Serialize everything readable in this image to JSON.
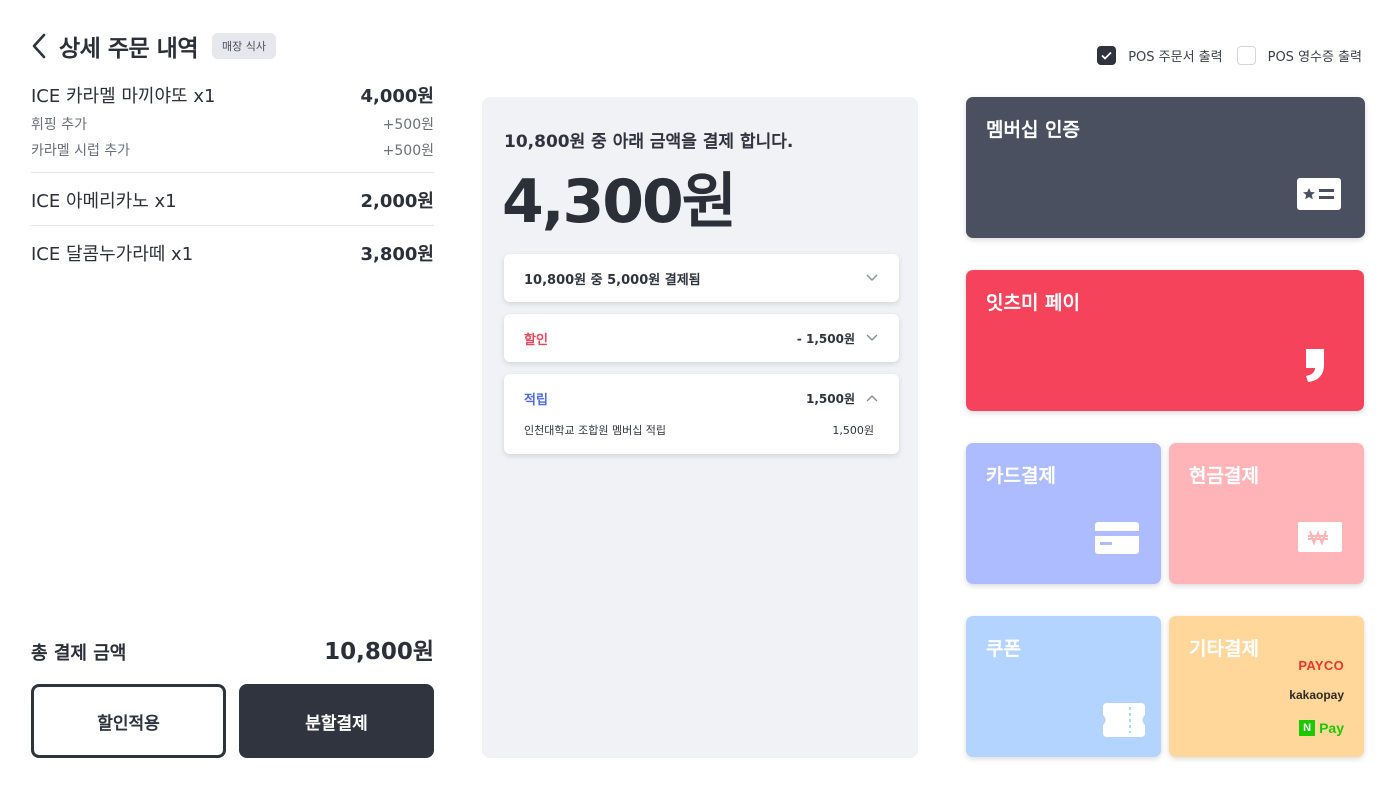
{
  "header": {
    "title": "상세 주문 내역",
    "badge": "매장 식사"
  },
  "order": {
    "items": [
      {
        "name": "ICE 카라멜 마끼야또 x1",
        "price": "4,000원",
        "options": [
          {
            "name": "휘핑 추가",
            "price": "+500원"
          },
          {
            "name": "카라멜 시럽 추가",
            "price": "+500원"
          }
        ]
      },
      {
        "name": "ICE 아메리카노 x1",
        "price": "2,000원",
        "options": []
      },
      {
        "name": "ICE 달콤누가라떼 x1",
        "price": "3,800원",
        "options": []
      }
    ],
    "total_label": "총 결제 금액",
    "total_value": "10,800원"
  },
  "buttons": {
    "discount": "할인적용",
    "split": "분할결제"
  },
  "payment_summary": {
    "description": "10,800원 중 아래 금액을 결제 합니다.",
    "amount": "4,300원",
    "paid_row": "10,800원 중 5,000원 결제됨",
    "discount_label": "할인",
    "discount_value": "- 1,500원",
    "points_label": "적립",
    "points_value": "1,500원",
    "points_detail_label": "인천대학교 조합원 멤버십 적립",
    "points_detail_value": "1,500원"
  },
  "print_options": {
    "order_slip": {
      "label": "POS 주문서 출력",
      "checked": true
    },
    "receipt": {
      "label": "POS 영수증 출력",
      "checked": false
    }
  },
  "payment_methods": {
    "membership": "멤버십 인증",
    "eatsme_pay": "잇츠미 페이",
    "card": "카드결제",
    "cash": "현금결제",
    "coupon": "쿠폰",
    "other": "기타결제",
    "other_brands": {
      "payco": "PAYCO",
      "kakaopay": "kakaopay",
      "npay_n": "N",
      "npay": "Pay"
    }
  },
  "colors": {
    "membership_tile": "#4a5060",
    "eatsme_tile": "#f5435b",
    "card_tile": "#adbbff",
    "cash_tile": "#ffb5b7",
    "coupon_tile": "#b3d4ff",
    "other_tile": "#ffd79a",
    "discount_red": "#e8485d",
    "points_blue": "#4e6be0"
  }
}
